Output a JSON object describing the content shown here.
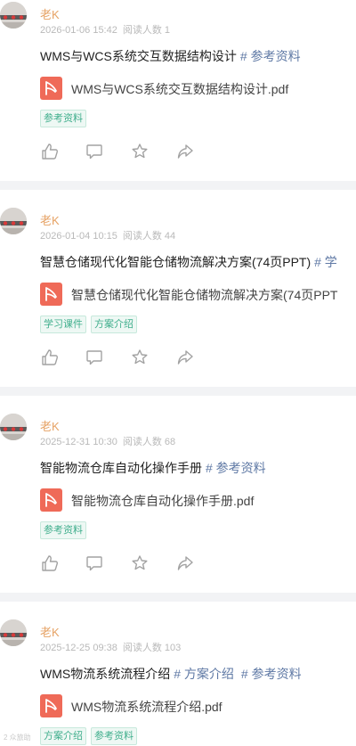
{
  "posts": [
    {
      "author": "老K",
      "date": "2026-01-06 15:42",
      "reads": "阅读人数 1",
      "title": "WMS与WCS系统交互数据结构设计",
      "tags": [
        "# 参考资料"
      ],
      "file": "WMS与WCS系统交互数据结构设计.pdf",
      "labels": [
        "参考资料"
      ]
    },
    {
      "author": "老K",
      "date": "2026-01-04 10:15",
      "reads": "阅读人数 44",
      "title": "智慧仓储现代化智能仓储物流解决方案(74页PPT)",
      "tags": [
        "# 学"
      ],
      "file": "智慧仓储现代化智能仓储物流解决方案(74页PPT",
      "labels": [
        "学习课件",
        "方案介绍"
      ]
    },
    {
      "author": "老K",
      "date": "2025-12-31 10:30",
      "reads": "阅读人数 68",
      "title": "智能物流仓库自动化操作手册",
      "tags": [
        "# 参考资料"
      ],
      "file": "智能物流仓库自动化操作手册.pdf",
      "labels": [
        "参考资料"
      ]
    },
    {
      "author": "老K",
      "date": "2025-12-25 09:38",
      "reads": "阅读人数 103",
      "title": "WMS物流系统流程介绍",
      "tags": [
        "# 方案介绍",
        "# 参考资料"
      ],
      "file": "WMS物流系统流程介绍.pdf",
      "labels": [
        "方案介绍",
        "参考资料"
      ]
    }
  ],
  "icons": {
    "avatar": "avatar-icon",
    "file": "pdf-icon",
    "like": "thumbs-up-icon",
    "comment": "comment-icon",
    "favorite": "star-icon",
    "share": "share-icon"
  },
  "colors": {
    "author": "#e6a264",
    "tag": "#5f79a5",
    "label_text": "#3fae8c",
    "pdf_icon": "#ef6a58",
    "separator": "#f2f3f5"
  },
  "watermark": "2 众旅助"
}
